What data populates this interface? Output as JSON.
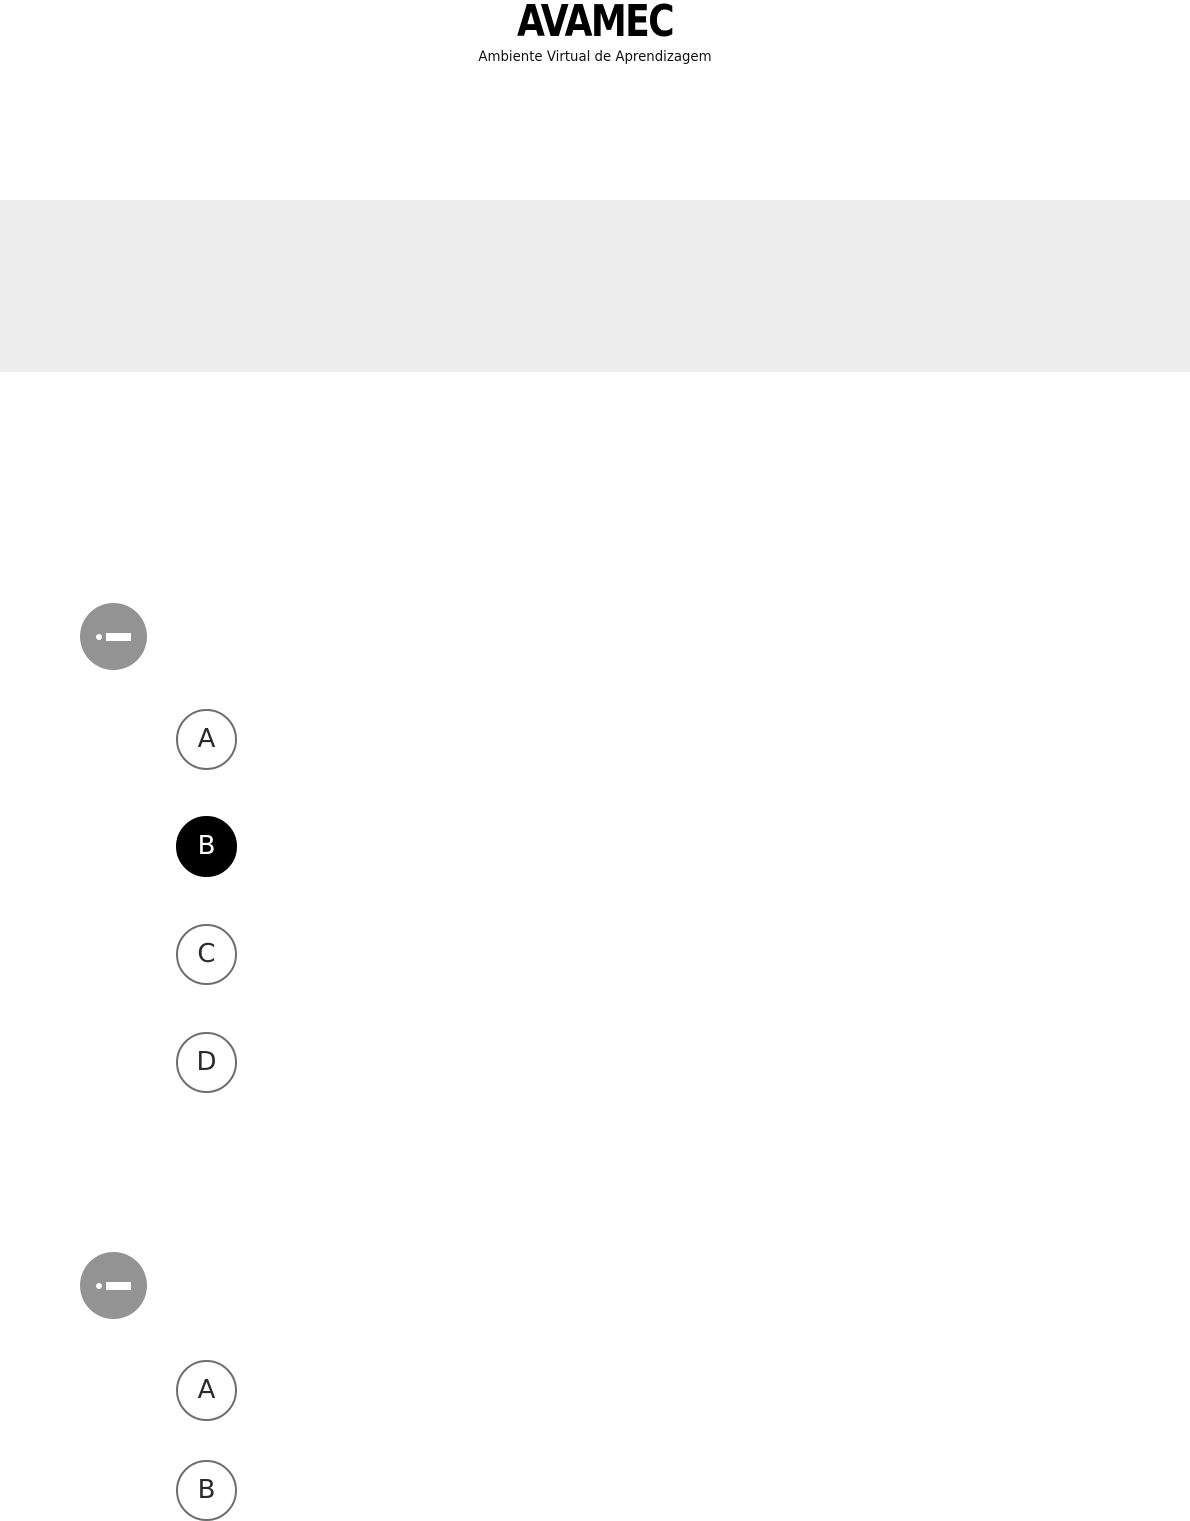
{
  "header": {
    "brand_title": "AVAMEC",
    "brand_subtitle": "Ambiente Virtual de Aprendizagem"
  },
  "questions": [
    {
      "marker_icon": "question-marker-icon",
      "options": [
        {
          "label": "A",
          "selected": false
        },
        {
          "label": "B",
          "selected": true
        },
        {
          "label": "C",
          "selected": false
        },
        {
          "label": "D",
          "selected": false
        }
      ]
    },
    {
      "marker_icon": "question-marker-icon",
      "options": [
        {
          "label": "A",
          "selected": false
        },
        {
          "label": "B",
          "selected": false
        }
      ]
    }
  ],
  "colors": {
    "banner": "#ededed",
    "marker": "#939393",
    "option_border": "#6e6e6e",
    "selected_fill": "#000000"
  }
}
